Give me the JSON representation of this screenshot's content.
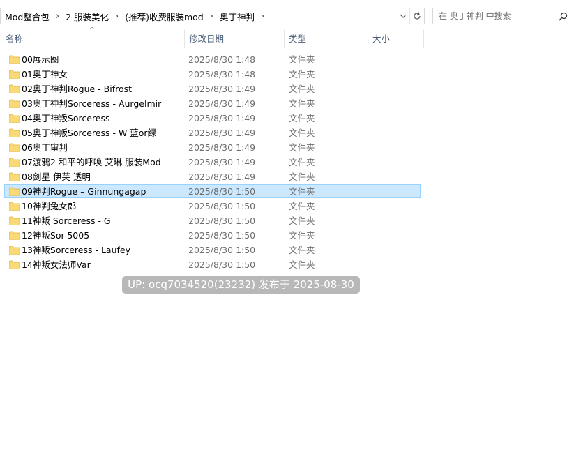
{
  "address_bar": {
    "breadcrumbs": [
      "Mod整合包",
      "2 服装美化",
      "(推荐)收费服装mod",
      "奥丁神判"
    ]
  },
  "search": {
    "placeholder": "在 奥丁神判 中搜索"
  },
  "columns": {
    "name": "名称",
    "date": "修改日期",
    "type": "类型",
    "size": "大小"
  },
  "files": [
    {
      "name": "00展示图",
      "date": "2025/8/30 1:48",
      "type": "文件夹",
      "selected": false
    },
    {
      "name": "01奥丁神女",
      "date": "2025/8/30 1:48",
      "type": "文件夹",
      "selected": false
    },
    {
      "name": "02奥丁神判Rogue - Bifrost",
      "date": "2025/8/30 1:49",
      "type": "文件夹",
      "selected": false
    },
    {
      "name": "03奥丁神判Sorceress - Aurgelmir",
      "date": "2025/8/30 1:49",
      "type": "文件夹",
      "selected": false
    },
    {
      "name": "04奥丁神叛Sorceress",
      "date": "2025/8/30 1:49",
      "type": "文件夹",
      "selected": false
    },
    {
      "name": "05奥丁神叛Sorceress - W 蓝or绿",
      "date": "2025/8/30 1:49",
      "type": "文件夹",
      "selected": false
    },
    {
      "name": "06奥丁审判",
      "date": "2025/8/30 1:49",
      "type": "文件夹",
      "selected": false
    },
    {
      "name": "07渡鸦2 和平的呼唤 艾琳 服装Mod",
      "date": "2025/8/30 1:49",
      "type": "文件夹",
      "selected": false
    },
    {
      "name": "08剑星 伊芙 透明",
      "date": "2025/8/30 1:49",
      "type": "文件夹",
      "selected": false
    },
    {
      "name": "09神判Rogue – Ginnungagap",
      "date": "2025/8/30 1:50",
      "type": "文件夹",
      "selected": true
    },
    {
      "name": "10神判兔女郎",
      "date": "2025/8/30 1:50",
      "type": "文件夹",
      "selected": false
    },
    {
      "name": "11神叛 Sorceress - G",
      "date": "2025/8/30 1:50",
      "type": "文件夹",
      "selected": false
    },
    {
      "name": "12神叛Sor-5005",
      "date": "2025/8/30 1:50",
      "type": "文件夹",
      "selected": false
    },
    {
      "name": "13神叛Sorceress - Laufey",
      "date": "2025/8/30 1:50",
      "type": "文件夹",
      "selected": false
    },
    {
      "name": "14神叛女法师Var",
      "date": "2025/8/30 1:50",
      "type": "文件夹",
      "selected": false
    }
  ],
  "watermark": "UP: ocq7034520(23232) 发布于 2025-08-30",
  "icons": {
    "folder": "folder-icon",
    "refresh": "refresh-icon",
    "search": "search-icon",
    "dropdown": "chevron-down-icon",
    "separator": "chevron-right-icon",
    "sort": "sort-ascending-icon"
  },
  "colors": {
    "folder": "#f8d775",
    "selection_bg": "#cce8ff",
    "selection_border": "#99d1ff",
    "header_text": "#4c607a",
    "secondary_text": "#6d6d6d"
  }
}
